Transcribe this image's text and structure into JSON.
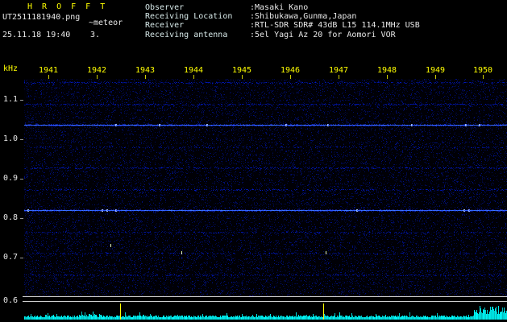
{
  "header": {
    "app_title": "H R O F F T",
    "filename": "UT2511181940.png",
    "observation_name": "~meteor",
    "datetime": "25.11.18 19:40",
    "echo_count": "3.",
    "info_rows": [
      {
        "label": "Observer",
        "value": ":Masaki Kano"
      },
      {
        "label": "Receiving Location",
        "value": ":Shibukawa,Gunma,Japan"
      },
      {
        "label": "Receiver",
        "value": ":RTL-SDR SDR# 43dB L15 114.1MHz USB"
      },
      {
        "label": "Receiving antenna",
        "value": ":5el Yagi Az 20 for Aomori VOR"
      }
    ]
  },
  "chart_data": {
    "type": "heatmap",
    "ylabel": "kHz",
    "x_ticks": [
      "1941",
      "1942",
      "1943",
      "1944",
      "1945",
      "1946",
      "1947",
      "1948",
      "1949",
      "1950"
    ],
    "y_ticks": [
      "1.1",
      "1.0",
      "0.9",
      "0.8",
      "0.7",
      "0.6"
    ],
    "ylim": [
      0.59,
      1.15
    ],
    "x_range": [
      "1940",
      "1950"
    ],
    "grid": false,
    "legend": "none",
    "carrier_lines_khz": [
      1.03,
      0.81
    ],
    "echo_marks": [
      {
        "t_frac": 0.18,
        "khz": 0.72
      },
      {
        "t_frac": 0.326,
        "khz": 0.7
      },
      {
        "t_frac": 0.626,
        "khz": 0.7
      }
    ],
    "noise_strip": {
      "marker_ticks_frac": [
        0.2,
        0.62
      ],
      "right_burst_start_frac": 0.93
    },
    "colors": {
      "background": "#000006",
      "noise_blue": "#0000aa",
      "carrier_blue": "#3c64ff",
      "time_labels": "#ffff00",
      "freq_labels": "#e8e8e8",
      "strip_bars": "#00e0e0",
      "frame_lines": "#cfcfcf"
    }
  }
}
